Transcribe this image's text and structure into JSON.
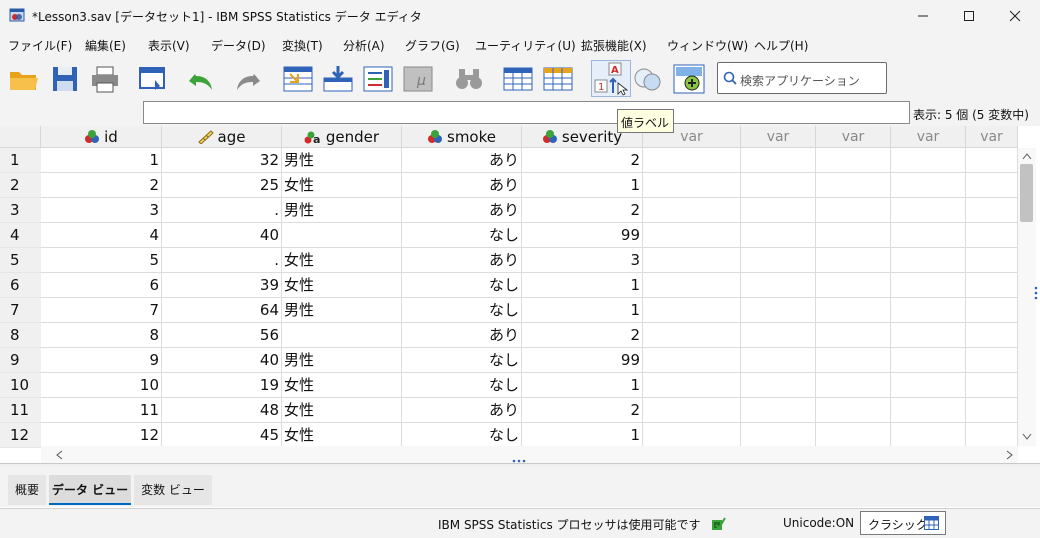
{
  "window": {
    "title": "*Lesson3.sav [データセット1] - IBM SPSS Statistics データ エディタ"
  },
  "menu": [
    "ファイル(F)",
    "編集(E)",
    "表示(V)",
    "データ(D)",
    "変換(T)",
    "分析(A)",
    "グラフ(G)",
    "ユーティリティ(U)",
    "拡張機能(X)",
    "ウィンドウ(W)",
    "ヘルプ(H)"
  ],
  "toolbar": {
    "search_placeholder": "検索アプリケーション",
    "tooltip": "値ラベル"
  },
  "cell_editor": {
    "value": "",
    "var_count": "表示: 5 個 (5 変数中)"
  },
  "columns": [
    {
      "name": "id",
      "measure": "nominal-icon"
    },
    {
      "name": "age",
      "measure": "scale-icon"
    },
    {
      "name": "gender",
      "measure": "nominal-string-icon"
    },
    {
      "name": "smoke",
      "measure": "nominal-icon"
    },
    {
      "name": "severity",
      "measure": "nominal-icon"
    },
    {
      "name": "var"
    },
    {
      "name": "var"
    },
    {
      "name": "var"
    },
    {
      "name": "var"
    },
    {
      "name": "var"
    }
  ],
  "rows": [
    {
      "n": "1",
      "id": "1",
      "age": "32",
      "gender": "男性",
      "smoke": "あり",
      "severity": "2"
    },
    {
      "n": "2",
      "id": "2",
      "age": "25",
      "gender": "女性",
      "smoke": "あり",
      "severity": "1"
    },
    {
      "n": "3",
      "id": "3",
      "age": ".",
      "gender": "男性",
      "smoke": "あり",
      "severity": "2"
    },
    {
      "n": "4",
      "id": "4",
      "age": "40",
      "gender": "",
      "smoke": "なし",
      "severity": "99"
    },
    {
      "n": "5",
      "id": "5",
      "age": ".",
      "gender": "女性",
      "smoke": "あり",
      "severity": "3"
    },
    {
      "n": "6",
      "id": "6",
      "age": "39",
      "gender": "女性",
      "smoke": "なし",
      "severity": "1"
    },
    {
      "n": "7",
      "id": "7",
      "age": "64",
      "gender": "男性",
      "smoke": "なし",
      "severity": "1"
    },
    {
      "n": "8",
      "id": "8",
      "age": "56",
      "gender": "",
      "smoke": "あり",
      "severity": "2"
    },
    {
      "n": "9",
      "id": "9",
      "age": "40",
      "gender": "男性",
      "smoke": "なし",
      "severity": "99"
    },
    {
      "n": "10",
      "id": "10",
      "age": "19",
      "gender": "女性",
      "smoke": "なし",
      "severity": "1"
    },
    {
      "n": "11",
      "id": "11",
      "age": "48",
      "gender": "女性",
      "smoke": "あり",
      "severity": "2"
    },
    {
      "n": "12",
      "id": "12",
      "age": "45",
      "gender": "女性",
      "smoke": "なし",
      "severity": "1"
    }
  ],
  "tabs": [
    "概要",
    "データ ビュー",
    "変数 ビュー"
  ],
  "active_tab": "データ ビュー",
  "status": {
    "processor": "IBM SPSS Statistics プロセッサは使用可能です",
    "unicode": "Unicode:ON",
    "classic": "クラシック"
  },
  "colors": {
    "accent": "#0067c0",
    "tooltip_bg": "#ffffe1",
    "header_bg": "#f0f0f0"
  }
}
